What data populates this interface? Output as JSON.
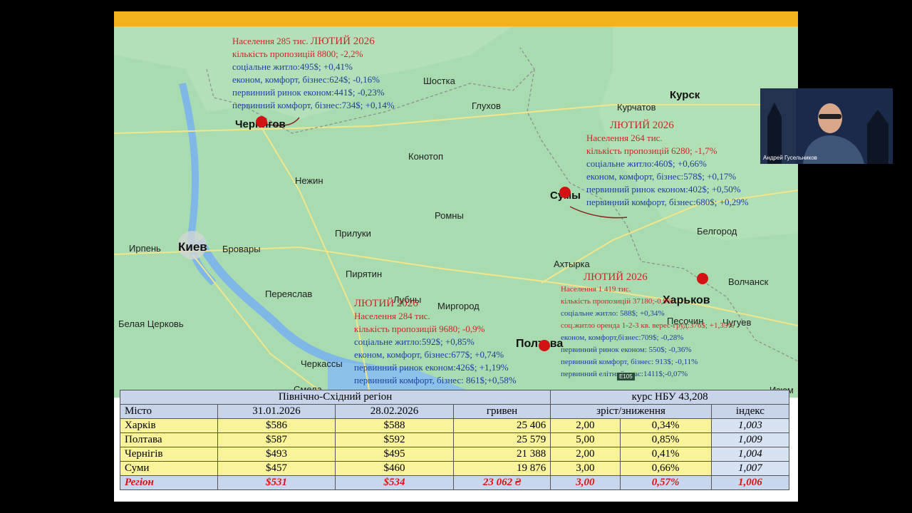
{
  "presenter": {
    "name": "Андрей Гусельников"
  },
  "map": {
    "cities": [
      {
        "id": "chernigov",
        "label": "Чернигов"
      },
      {
        "id": "shostka",
        "label": "Шостка"
      },
      {
        "id": "kursk",
        "label": "Курск"
      },
      {
        "id": "kurchatov",
        "label": "Курчатов"
      },
      {
        "id": "glukhov",
        "label": "Глухов"
      },
      {
        "id": "konotop",
        "label": "Конотоп"
      },
      {
        "id": "nezhin",
        "label": "Нежин"
      },
      {
        "id": "sumy",
        "label": "Сумы"
      },
      {
        "id": "romny",
        "label": "Ромны"
      },
      {
        "id": "priluki",
        "label": "Прилуки"
      },
      {
        "id": "belgorod",
        "label": "Белгород"
      },
      {
        "id": "irpen",
        "label": "Ирпень"
      },
      {
        "id": "kiev",
        "label": "Киев"
      },
      {
        "id": "brovary",
        "label": "Бровары"
      },
      {
        "id": "akhtyrka",
        "label": "Ахтырка"
      },
      {
        "id": "piryatin",
        "label": "Пирятин"
      },
      {
        "id": "volchansk",
        "label": "Волчанск"
      },
      {
        "id": "pereyaslav",
        "label": "Переяслав"
      },
      {
        "id": "lubny",
        "label": "Лубны"
      },
      {
        "id": "mirgorod",
        "label": "Миргород"
      },
      {
        "id": "kharkov",
        "label": "Харьков"
      },
      {
        "id": "belaya",
        "label": "Белая Церковь"
      },
      {
        "id": "pesochin",
        "label": "Песочин"
      },
      {
        "id": "chuguev",
        "label": "Чугуев"
      },
      {
        "id": "poltava",
        "label": "Полтава"
      },
      {
        "id": "cherkassy",
        "label": "Черкассы"
      },
      {
        "id": "smela",
        "label": "Смела"
      },
      {
        "id": "izyum",
        "label": "Изюм"
      }
    ],
    "watermark": "E105"
  },
  "chernigiv_info": {
    "month": "ЛЮТИЙ 2026",
    "population": "Населення 285 тис.",
    "offers": "кількість пропозицій 8800; -2,2%",
    "social": "соціальне житло:495$; +0,41%",
    "econom": "економ, комфорт, бізнес:624$; -0,16%",
    "primary_econom": "первинний ринок економ:441$; -0,23%",
    "primary_comfort": "первинний комфорт, бізнес:734$; +0,14%"
  },
  "sumy_info": {
    "month": "ЛЮТИЙ 2026",
    "population": "Населення 264 тис.",
    "offers": "кількість пропозицій 6280; -1,7%",
    "social": "соціальне житло:460$; +0,66%",
    "econom": "економ, комфорт, бізнес:578$; +0,17%",
    "primary_econom": "первинний ринок економ:402$; +0,50%",
    "primary_comfort": "первинний комфорт, бізнес:680$; +0,29%"
  },
  "poltava_info": {
    "month": "ЛЮТИЙ 2026",
    "population": "Населення 284 тис.",
    "offers": "кількість пропозицій 9680; -0,9%",
    "social": "соціальне житло:592$; +0,85%",
    "econom": "економ, комфорт, бізнес:677$; +0,74%",
    "primary_econom": "первинний ринок економ:426$; +1,19%",
    "primary_comfort": "первинний комфорт, бізнес: 861$;+0,58%"
  },
  "kharkiv_info": {
    "month": "ЛЮТИЙ 2026",
    "population": "Населення 1 419 тис.",
    "offers": "кількість пропозицій 37180;-0,9%",
    "social": "соціальне житло: 588$; +0,34%",
    "rent": "соц.житло оренда 1-2-3 кв. верес-груд:376$; +1,35%",
    "econom": "економ, комфорт,бізнес:709$; -0,28%",
    "primary_econom": "первинний ринок економ: 550$; -0,36%",
    "primary_comfort": "первинний комфорт, бізнес: 913$; -0,11%",
    "elite": "первинний елітний клас:1411$;-0,07%"
  },
  "table": {
    "region_title": "Північно-Східний регіон",
    "rate_title": "курс НБУ 43,208",
    "headers": [
      "Місто",
      "31.01.2026",
      "28.02.2026",
      "гривен",
      "зріст/зниження",
      "індекс"
    ],
    "rows": [
      {
        "city": "Харків",
        "jan": "$586",
        "feb": "$588",
        "uah": "25 406",
        "abs": "2,00",
        "pct": "0,34%",
        "idx": "1,003"
      },
      {
        "city": "Полтава",
        "jan": "$587",
        "feb": "$592",
        "uah": "25 579",
        "abs": "5,00",
        "pct": "0,85%",
        "idx": "1,009"
      },
      {
        "city": "Чернігів",
        "jan": "$493",
        "feb": "$495",
        "uah": "21 388",
        "abs": "2,00",
        "pct": "0,41%",
        "idx": "1,004"
      },
      {
        "city": "Суми",
        "jan": "$457",
        "feb": "$460",
        "uah": "19 876",
        "abs": "3,00",
        "pct": "0,66%",
        "idx": "1,007"
      }
    ],
    "region": {
      "city": "Регіон",
      "jan": "$531",
      "feb": "$534",
      "uah": "23 062 ₴",
      "abs": "3,00",
      "pct": "0,57%",
      "idx": "1,006"
    }
  }
}
